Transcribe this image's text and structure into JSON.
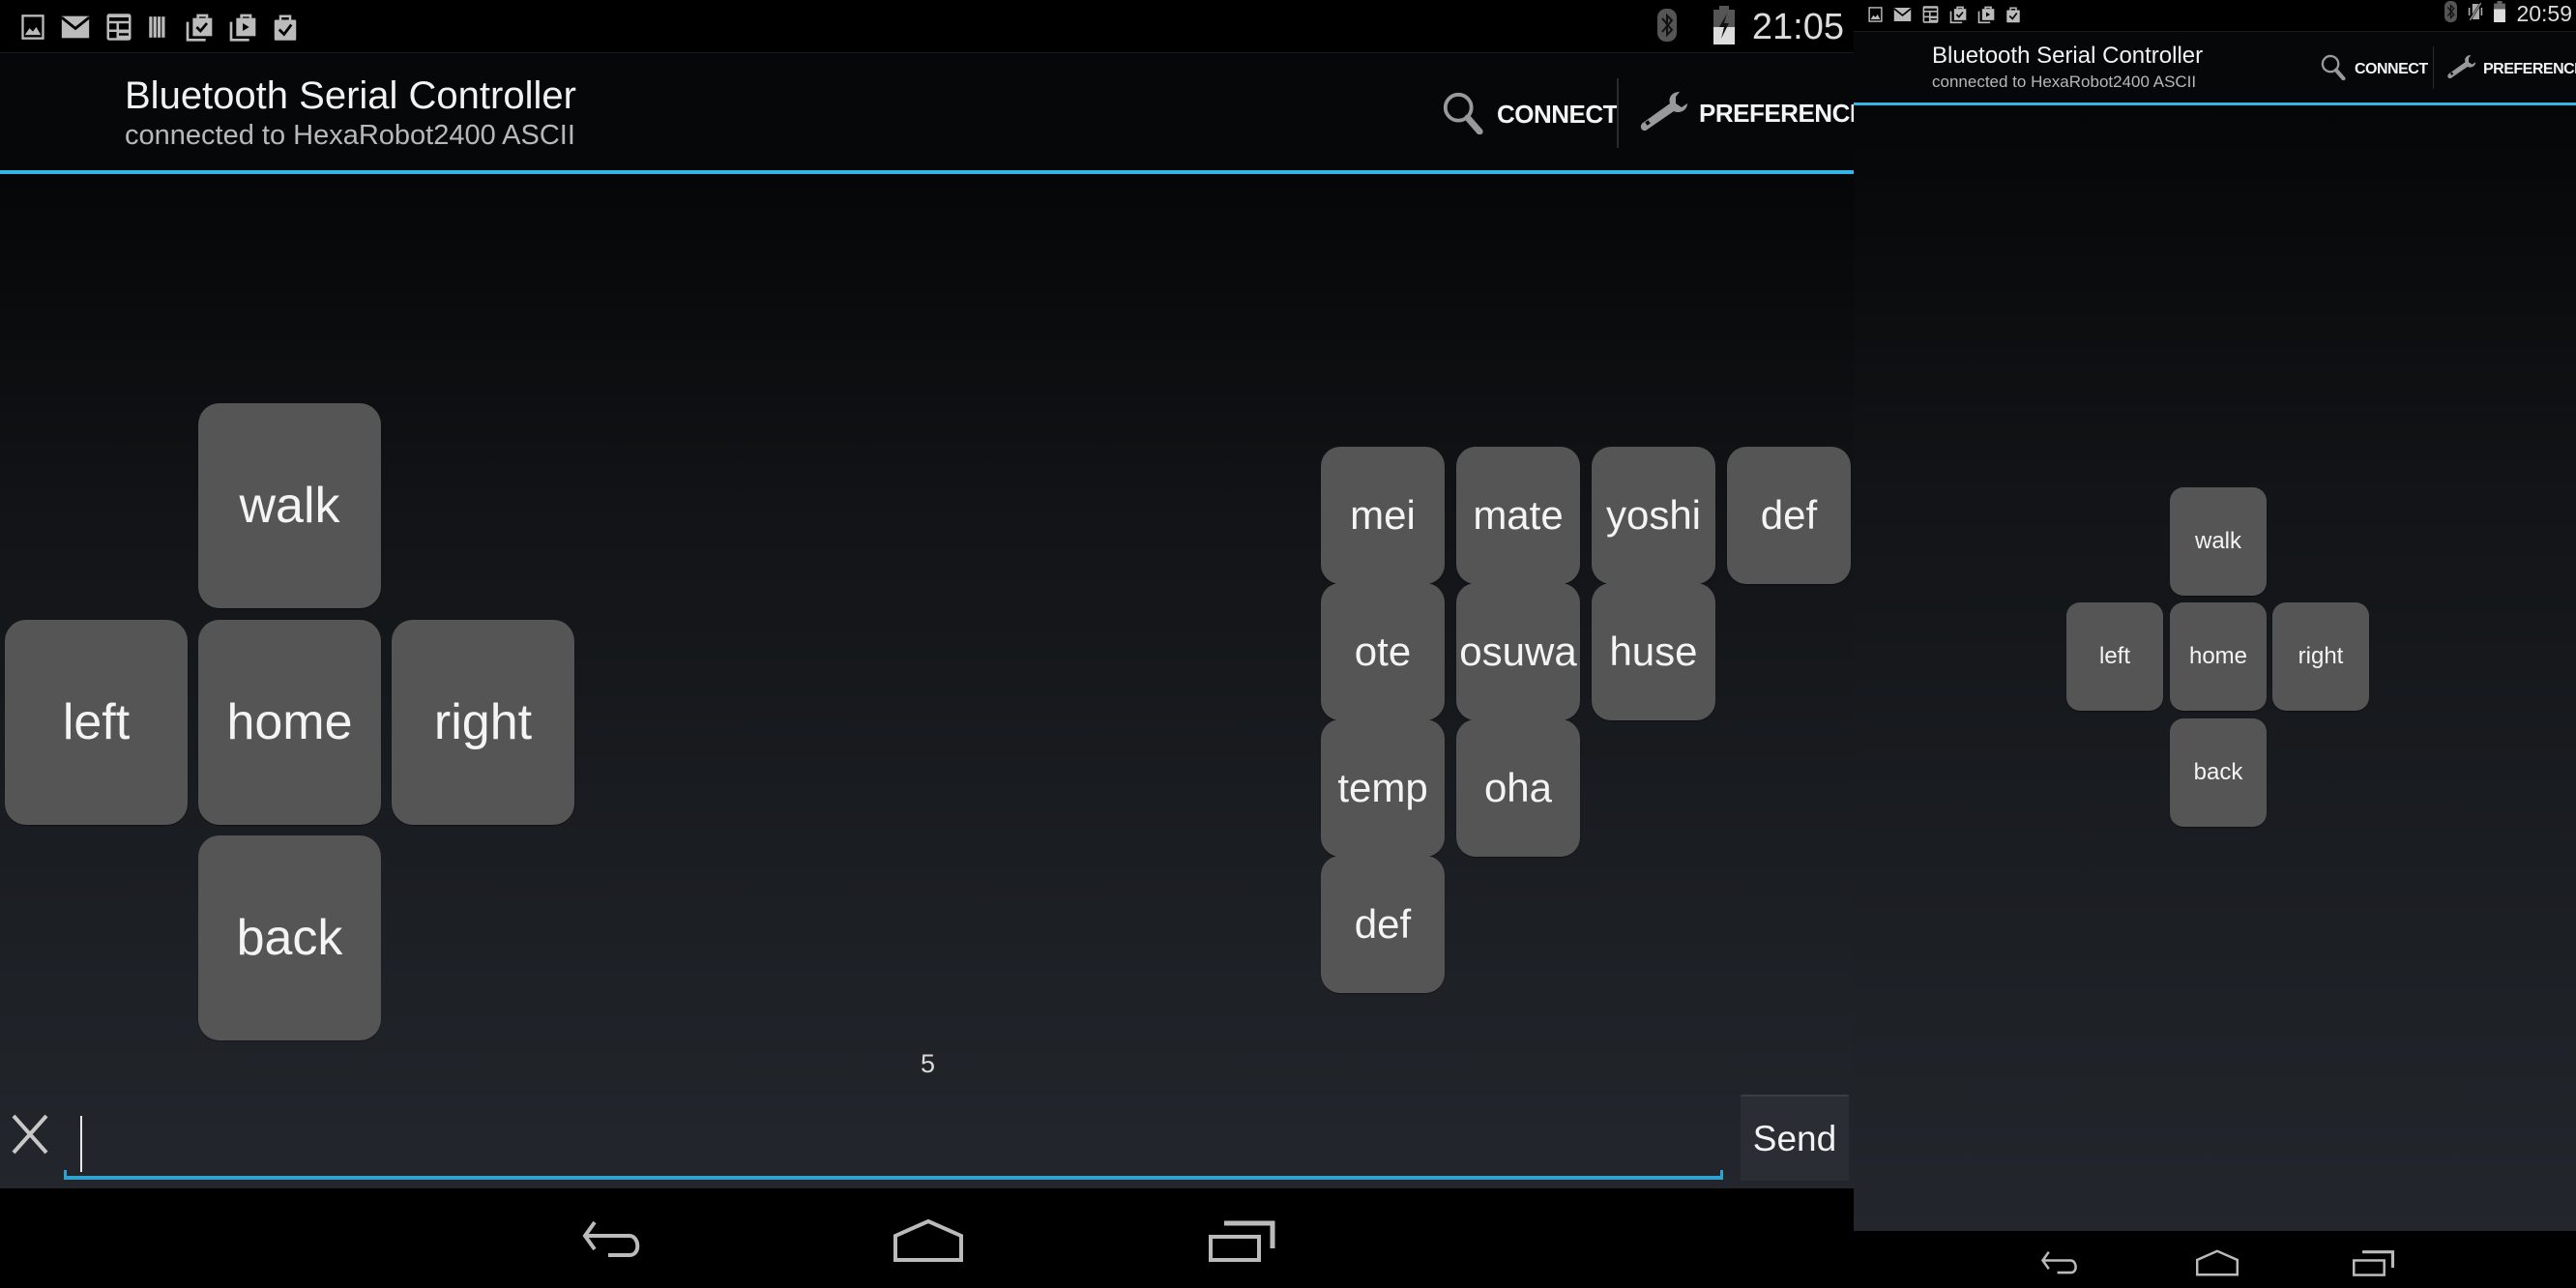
{
  "screens": [
    {
      "status_bar": {
        "notification_icons": [
          "image-icon",
          "mail-icon",
          "news-icon",
          "barcode-icon",
          "store-check-stack-icon",
          "store-play-stack-icon",
          "store-check-icon"
        ],
        "system_icons": [
          "bluetooth-icon",
          "battery-charging-icon"
        ],
        "time": "21:05"
      },
      "action_bar": {
        "title": "Bluetooth Serial Controller",
        "subtitle": "connected to HexaRobot2400  ASCII",
        "connect_label": "CONNECT",
        "preference_label": "PREFERENCE"
      },
      "dpad": {
        "up": "walk",
        "left": "left",
        "center": "home",
        "right": "right",
        "down": "back"
      },
      "command_grid": [
        [
          "mei",
          "mate",
          "yoshi",
          "def"
        ],
        [
          "ote",
          "osuwa",
          "huse"
        ],
        [
          "temp",
          "oha"
        ],
        [
          "def"
        ]
      ],
      "counter": "5",
      "input": {
        "value": "",
        "placeholder": ""
      },
      "send_label": "Send"
    },
    {
      "status_bar": {
        "notification_icons": [
          "image-icon",
          "mail-icon",
          "news-icon",
          "store-check-stack-icon",
          "store-play-stack-icon",
          "store-check-icon"
        ],
        "system_icons": [
          "bluetooth-icon",
          "vibrate-off-icon",
          "battery-icon"
        ],
        "time": "20:59"
      },
      "action_bar": {
        "title": "Bluetooth Serial Controller",
        "subtitle": "connected to HexaRobot2400  ASCII",
        "connect_label": "CONNECT",
        "preference_label": "PREFERENCE"
      },
      "dpad": {
        "up": "walk",
        "left": "left",
        "center": "home",
        "right": "right",
        "down": "back"
      }
    }
  ],
  "colors": {
    "accent": "#33b5e5",
    "button": "#555555",
    "background_top": "#050607",
    "background_bottom": "#23272d"
  }
}
